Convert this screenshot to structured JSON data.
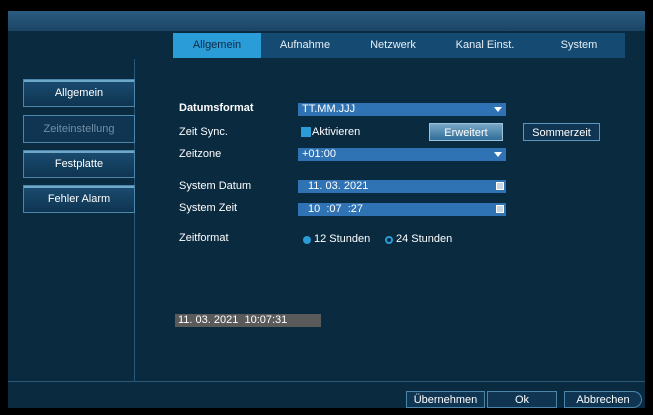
{
  "tabs": [
    "Allgemein",
    "Aufnahme",
    "Netzwerk",
    "Kanal Einst.",
    "System"
  ],
  "sidebar": [
    {
      "label": "Allgemein"
    },
    {
      "label": "Zeiteinstellung"
    },
    {
      "label": "Festplatte"
    },
    {
      "label": "Fehler Alarm"
    }
  ],
  "form": {
    "datumsformat_label": "Datumsformat",
    "datumsformat_value": "TT.MM.JJJ",
    "zeitsync_label": "Zeit Sync.",
    "aktivieren_label": "Aktivieren",
    "erweitert_button": "Erweitert",
    "sommerzeit_button": "Sommerzeit",
    "zeitzone_label": "Zeitzone",
    "zeitzone_value": "+01:00",
    "systemdatum_label": "System Datum",
    "systemdatum_value": "11. 03. 2021",
    "systemzeit_label": "System Zeit",
    "systemzeit_value": "10  :07  :27",
    "zeitformat_label": "Zeitformat",
    "radio_12": "12 Stunden",
    "radio_24": "24 Stunden"
  },
  "clock": "11. 03. 2021  10:07:31",
  "footer": {
    "apply": "Übernehmen",
    "ok": "Ok",
    "cancel": "Abbrechen"
  },
  "colors": {
    "background": "#0a2a40",
    "accent": "#2a9dd8",
    "field": "#2f73b4"
  }
}
